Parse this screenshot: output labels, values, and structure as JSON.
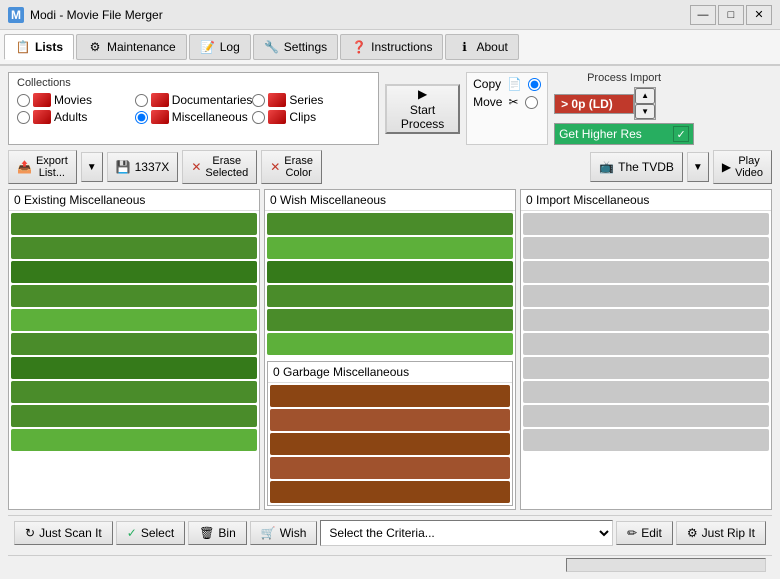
{
  "titleBar": {
    "icon": "M",
    "title": "Modi - Movie File Merger",
    "minimize": "—",
    "maximize": "□",
    "close": "✕"
  },
  "menuBar": {
    "tabs": [
      {
        "id": "lists",
        "label": "Lists",
        "icon": "📋",
        "active": true
      },
      {
        "id": "maintenance",
        "label": "Maintenance",
        "icon": "⚙",
        "active": false
      },
      {
        "id": "log",
        "label": "Log",
        "icon": "📝",
        "active": false
      },
      {
        "id": "settings",
        "label": "Settings",
        "icon": "🔧",
        "active": false
      },
      {
        "id": "instructions",
        "label": "Instructions",
        "icon": "❓",
        "active": false
      },
      {
        "id": "about",
        "label": "About",
        "icon": "ℹ",
        "active": false
      }
    ]
  },
  "collections": {
    "title": "Collections",
    "items": [
      {
        "id": "movies",
        "label": "Movies",
        "checked": false
      },
      {
        "id": "documentaries",
        "label": "Documentaries",
        "checked": false
      },
      {
        "id": "series",
        "label": "Series",
        "checked": false
      },
      {
        "id": "adults",
        "label": "Adults",
        "checked": false
      },
      {
        "id": "miscellaneous",
        "label": "Miscellaneous",
        "checked": true
      },
      {
        "id": "clips",
        "label": "Clips",
        "checked": false
      }
    ]
  },
  "processImport": {
    "label": "Process Import",
    "value": "> 0p (LD)",
    "getHigherRes": "Get Higher Res"
  },
  "startProcess": {
    "label": "Start\nProcess"
  },
  "copyMove": {
    "copyLabel": "Copy",
    "moveLabel": "Move"
  },
  "toolbar": {
    "exportList": "Export\nList...",
    "drive": "1337X",
    "eraseSelected": "Erase\nSelected",
    "eraseColor": "Erase\nColor",
    "thetvdb": "The TVDB",
    "playVideo": "Play\nVideo"
  },
  "panels": {
    "existing": {
      "title": "0 Existing Miscellaneous",
      "rows": 10
    },
    "wish": {
      "title": "0 Wish Miscellaneous",
      "rows": 6,
      "subTitle": "0 Garbage Miscellaneous",
      "subRows": 5
    },
    "import": {
      "title": "0 Import Miscellaneous",
      "rows": 10
    }
  },
  "bottomBar": {
    "justScan": "Just Scan It",
    "select": "Select",
    "bin": "Bin",
    "wish": "Wish",
    "criteria": "Select the Criteria...",
    "edit": "Edit",
    "justRip": "Just Rip It"
  }
}
